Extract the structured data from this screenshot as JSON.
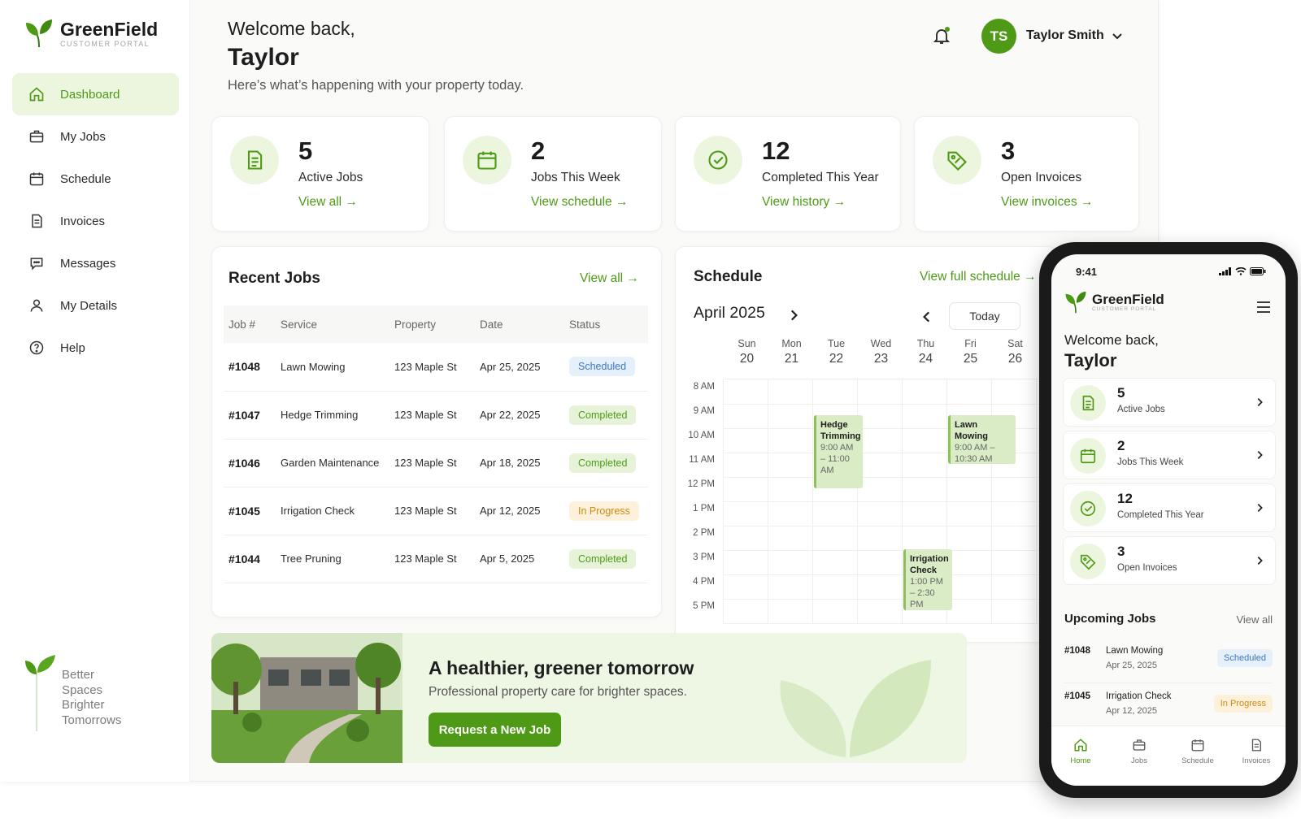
{
  "brand": {
    "name": "GreenField",
    "sub": "CUSTOMER PORTAL",
    "color": "#4e9a16"
  },
  "sidebar": {
    "items": [
      {
        "label": "Dashboard",
        "icon": "home-icon"
      },
      {
        "label": "My Jobs",
        "icon": "briefcase-icon"
      },
      {
        "label": "Schedule",
        "icon": "calendar-icon"
      },
      {
        "label": "Invoices",
        "icon": "document-icon"
      },
      {
        "label": "Messages",
        "icon": "chat-icon"
      },
      {
        "label": "My Details",
        "icon": "user-icon"
      },
      {
        "label": "Help",
        "icon": "help-icon"
      }
    ],
    "tagline": [
      "Better",
      "Spaces",
      "Brighter",
      "Tomorrows"
    ]
  },
  "header": {
    "greeting": "Welcome back,",
    "name": "Taylor",
    "subtitle": "Here’s what’s happening with your property today.",
    "user_initials": "TS",
    "user_name": "Taylor Smith"
  },
  "stats": [
    {
      "value": "5",
      "label": "Active Jobs",
      "link": "View all →",
      "icon": "document-icon"
    },
    {
      "value": "2",
      "label": "Jobs This Week",
      "link": "View schedule →",
      "icon": "calendar-icon"
    },
    {
      "value": "12",
      "label": "Completed This Year",
      "link": "View history →",
      "icon": "check-circle-icon"
    },
    {
      "value": "3",
      "label": "Open Invoices",
      "link": "View invoices →",
      "icon": "tag-icon"
    }
  ],
  "recent_jobs": {
    "title": "Recent Jobs",
    "view_all": "View all →",
    "columns": [
      "Job #",
      "Service",
      "Property",
      "Date",
      "Status"
    ],
    "rows": [
      {
        "id": "#1048",
        "service": "Lawn Mowing",
        "property": "123 Maple St",
        "date": "Apr 25, 2025",
        "status": "Scheduled"
      },
      {
        "id": "#1047",
        "service": "Hedge Trimming",
        "property": "123 Maple St",
        "date": "Apr 22, 2025",
        "status": "Completed"
      },
      {
        "id": "#1046",
        "service": "Garden Maintenance",
        "property": "123 Maple St",
        "date": "Apr 18, 2025",
        "status": "Completed"
      },
      {
        "id": "#1045",
        "service": "Irrigation Check",
        "property": "123 Maple St",
        "date": "Apr 12, 2025",
        "status": "In Progress"
      },
      {
        "id": "#1044",
        "service": "Tree Pruning",
        "property": "123 Maple St",
        "date": "Apr 5, 2025",
        "status": "Completed"
      }
    ]
  },
  "schedule": {
    "title": "Schedule",
    "view_full": "View full schedule →",
    "month": "April 2025",
    "today": "Today",
    "days": [
      {
        "name": "Sun",
        "date": "20"
      },
      {
        "name": "Mon",
        "date": "21"
      },
      {
        "name": "Tue",
        "date": "22"
      },
      {
        "name": "Wed",
        "date": "23"
      },
      {
        "name": "Thu",
        "date": "24"
      },
      {
        "name": "Fri",
        "date": "25"
      },
      {
        "name": "Sat",
        "date": "26"
      }
    ],
    "hours": [
      "8 AM",
      "9 AM",
      "10 AM",
      "11 AM",
      "12 PM",
      "1 PM",
      "2 PM",
      "3 PM",
      "4 PM",
      "5 PM"
    ],
    "events": [
      {
        "title": "Hedge Trimming",
        "time": "9:00 AM – 11:00 AM",
        "day": 2,
        "start": 9,
        "end": 12
      },
      {
        "title": "Lawn Mowing",
        "time": "9:00 AM – 10:30 AM",
        "day": 5,
        "start": 9,
        "end": 11
      },
      {
        "title": "Irrigation Check",
        "time": "1:00 PM – 2:30 PM",
        "day": 4,
        "start": 14.5,
        "end": 17
      }
    ]
  },
  "banner": {
    "title": "A healthier, greener tomorrow",
    "subtitle": "Professional property care for brighter spaces.",
    "button": "Request a New Job"
  },
  "phone": {
    "time": "9:41",
    "greeting": "Welcome back,",
    "name": "Taylor",
    "stats": [
      {
        "value": "5",
        "label": "Active Jobs"
      },
      {
        "value": "2",
        "label": "Jobs This Week"
      },
      {
        "value": "12",
        "label": "Completed This Year"
      },
      {
        "value": "3",
        "label": "Open Invoices"
      }
    ],
    "upcoming_title": "Upcoming Jobs",
    "view_all": "View all",
    "upcoming": [
      {
        "id": "#1048",
        "service": "Lawn Mowing",
        "date": "Apr 25, 2025",
        "status": "Scheduled"
      },
      {
        "id": "#1045",
        "service": "Irrigation Check",
        "date": "Apr 12, 2025",
        "status": "In Progress"
      }
    ],
    "tabs": [
      "Home",
      "Jobs",
      "Schedule",
      "Invoices"
    ]
  }
}
